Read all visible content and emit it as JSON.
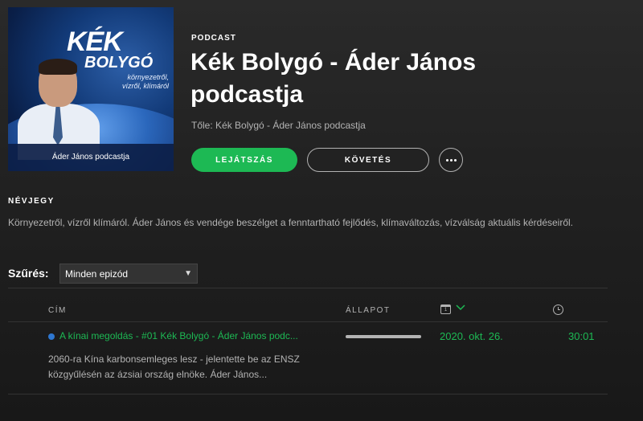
{
  "cover": {
    "line1": "KÉK",
    "line2": "BOLYGÓ",
    "subtitle": "környezetről, vízről, klímáról",
    "caption": "Áder János podcastja"
  },
  "header": {
    "type_label": "PODCAST",
    "title": "Kék Bolygó - Áder János podcastja",
    "author": "Tőle: Kék Bolygó - Áder János podcastja"
  },
  "actions": {
    "play_label": "LEJÁTSZÁS",
    "follow_label": "KÖVETÉS",
    "more_icon": "more-dots-icon"
  },
  "about": {
    "heading": "NÉVJEGY",
    "text": "Környezetről, vízről klímáról. Áder János és vendége beszélget a fenntartható fejlődés, klímaváltozás, vízválság aktuális kérdéseiről."
  },
  "filter": {
    "label": "Szűrés:",
    "selected": "Minden epizód"
  },
  "table": {
    "col_title": "CÍM",
    "col_status": "ÁLLAPOT",
    "date_icon": "calendar-icon",
    "sort_icon": "chevron-down-icon",
    "duration_icon": "clock-icon"
  },
  "episodes": [
    {
      "title": "A kínai megoldás - #01 Kék Bolygó - Áder János podc...",
      "description": "2060-ra Kína karbonsemleges lesz - jelentette be az ENSZ közgyűlésén az ázsiai ország elnöke. Áder János...",
      "date": "2020. okt. 26.",
      "duration": "30:01",
      "progress": 1.0
    }
  ],
  "colors": {
    "accent": "#1db954",
    "unplayed_dot": "#2e77d0",
    "background": "#181818",
    "muted_text": "#b3b3b3"
  }
}
